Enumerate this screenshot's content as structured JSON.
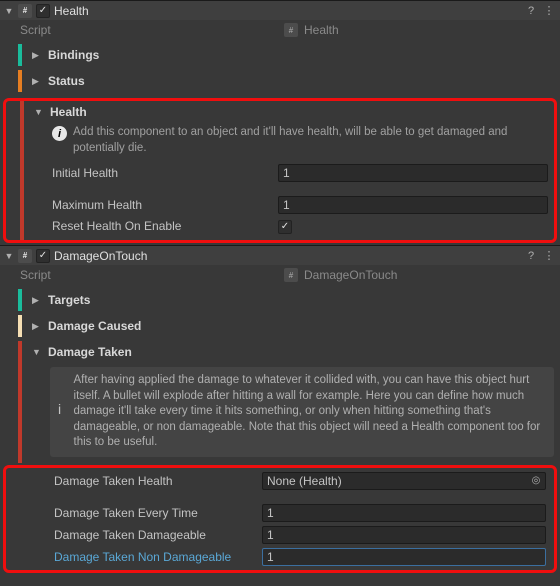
{
  "health": {
    "header_title": "Health",
    "script_label": "Script",
    "script_value": "Health",
    "sections": {
      "bindings": "Bindings",
      "status": "Status",
      "health": "Health"
    },
    "health_info": "Add this component to an object and it'll have health, will be able to get damaged and potentially die.",
    "fields": {
      "initial_health_label": "Initial Health",
      "initial_health_value": "1",
      "maximum_health_label": "Maximum Health",
      "maximum_health_value": "1",
      "reset_label": "Reset Health On Enable",
      "reset_value": true
    }
  },
  "dot": {
    "header_title": "DamageOnTouch",
    "script_label": "Script",
    "script_value": "DamageOnTouch",
    "sections": {
      "targets": "Targets",
      "damage_caused": "Damage Caused",
      "damage_taken": "Damage Taken"
    },
    "dt_info": "After having applied the damage to whatever it collided with, you can have this object hurt itself. A bullet will explode after hitting a wall for example. Here you can define how much damage it'll take every time it hits something, or only when hitting something that's damageable, or non damageable. Note that this object will need a Health component too for this to be useful.",
    "fields": {
      "dt_health_label": "Damage Taken Health",
      "dt_health_value": "None (Health)",
      "dt_every_label": "Damage Taken Every Time",
      "dt_every_value": "1",
      "dt_dmg_label": "Damage Taken Damageable",
      "dt_dmg_value": "1",
      "dt_non_label": "Damage Taken Non Damageable",
      "dt_non_value": "1"
    }
  }
}
